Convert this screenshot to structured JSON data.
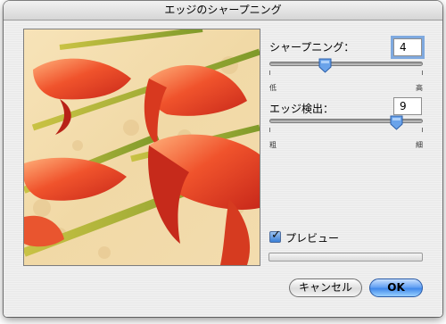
{
  "window": {
    "title": "エッジのシャープニング"
  },
  "sharpening": {
    "label": "シャープニング：",
    "value": "4",
    "level_fraction": 0.35,
    "min_label": "低",
    "max_label": "高"
  },
  "edge": {
    "label": "エッジ検出：",
    "value": "9",
    "level_fraction": 0.86,
    "min_label": "粗",
    "max_label": "細"
  },
  "preview_option": {
    "label": "プレビュー",
    "checked": true
  },
  "buttons": {
    "cancel": "キャンセル",
    "ok": "OK"
  }
}
